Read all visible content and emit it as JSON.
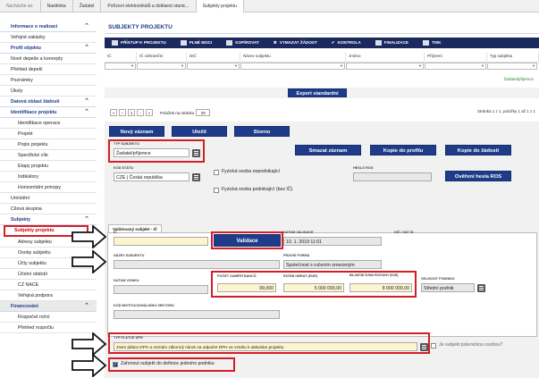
{
  "breadcrumb": [
    "Nastěnka",
    "Žadatel",
    "Pořízení elektronikálů a doblaest stanic...",
    "Subjekty projektu"
  ],
  "breadcrumb_home": "Nacházíte se:",
  "sidebar": {
    "items": [
      {
        "label": "Informace o realizaci",
        "type": "sec",
        "chev": "⌃"
      },
      {
        "label": "Veřejné zakázky",
        "type": "plain"
      },
      {
        "label": "Profil objektu",
        "type": "sec",
        "chev": "⌃"
      },
      {
        "label": "Nové depeše a koncepty",
        "type": "plain"
      },
      {
        "label": "Přehled depeší",
        "type": "plain"
      },
      {
        "label": "Poznámky",
        "type": "plain"
      },
      {
        "label": "Úkoly",
        "type": "plain"
      },
      {
        "label": "Datová oblast žádosti",
        "type": "sec",
        "chev": "⌃"
      },
      {
        "label": "Identifikace projektu",
        "type": "sec",
        "chev": "⌃"
      },
      {
        "label": "Identifikace operace",
        "type": "sub"
      },
      {
        "label": "Projekt",
        "type": "sub"
      },
      {
        "label": "Popis projektu",
        "type": "sub"
      },
      {
        "label": "Specifické cíle",
        "type": "sub"
      },
      {
        "label": "Etapy projektu",
        "type": "sub"
      },
      {
        "label": "Indikátory",
        "type": "sub"
      },
      {
        "label": "Horizontální principy",
        "type": "sub"
      },
      {
        "label": "Umístění",
        "type": "plain"
      },
      {
        "label": "Cílová skupina",
        "type": "plain"
      },
      {
        "label": "Subjekty",
        "type": "sec",
        "chev": "⌃"
      },
      {
        "label": "Subjekty projektu",
        "type": "active"
      },
      {
        "label": "Adresy subjektu",
        "type": "sub"
      },
      {
        "label": "Osoby subjektu",
        "type": "sub"
      },
      {
        "label": "Účty subjektu",
        "type": "sub"
      },
      {
        "label": "Účetní období",
        "type": "sub"
      },
      {
        "label": "CZ NACE",
        "type": "sub"
      },
      {
        "label": "Veřejná podpora",
        "type": "sub"
      },
      {
        "label": "Financování",
        "type": "secgrey",
        "chev": "⌃"
      },
      {
        "label": "Rozpočet roční",
        "type": "sub"
      },
      {
        "label": "Přehled rozpočtu",
        "type": "sub"
      }
    ]
  },
  "main": {
    "title": "SUBJEKTY PROJEKTU",
    "toolbar": [
      "PŘÍSTUP K PROJEKTU",
      "PLNÉ MOCI",
      "KOPÍROVAT",
      "VYMAZAT ŽÁDOST",
      "KONTROLA",
      "FINALIZACE",
      "TISK"
    ],
    "columns": [
      "IČ",
      "IČ zahraniční",
      "DIČ",
      "Název subjektu",
      "Jméno",
      "Příjmení",
      "Typ subjektu"
    ],
    "row_type": "Žadatel/přijemce",
    "export_label": "Export standardní",
    "pager": {
      "page": "1",
      "per_page_label": "Položek na stránku",
      "per_page": "25",
      "summary": "Stránka 1 z 1, položky 1 až 1 z 1"
    }
  },
  "form": {
    "btn_new": "Nový záznam",
    "btn_save": "Uložit",
    "btn_cancel": "Storno",
    "btn_delete": "Smazat záznam",
    "btn_copy_profile": "Kopie do profilu",
    "btn_copy_request": "Kopie do žádosti",
    "btn_verify_ros": "Ověření hesla ROS",
    "typ_subjektu_label": "TYP SUBJEKTU",
    "typ_subjektu": "Žadatel/příjemce",
    "kod_statu_label": "KÓD STÁTU",
    "kod_statu": "CZE | Česká republika",
    "fyz_nepod": "Fyzická osoba nepodnikající",
    "fyz_pod": "Fyzická osoba podnikající (bez IČ)",
    "heslo_ros_label": "HESLO ROS",
    "tab_label": "Validovaný subjekt - IČ",
    "ic_label": "IČ",
    "ic_value": "",
    "validace": "Validace",
    "datum_validace_label": "DATUM VALIDACE",
    "datum_validace": "10. 1. 2019 11:01",
    "dic_label": "DIČ / VAT ID",
    "nazev_label": "NÁZEV SUBJEKTU",
    "pravni_forma_label": "PRÁVNÍ FORMA",
    "pravni_forma": "Společnost s ručením omezeným",
    "datum_vzniku_label": "DATUM VZNIKU",
    "pocet_zam_label": "POČET ZAMĚSTNANCŮ",
    "pocet_zam": "99,000",
    "obrat_label": "ROČNÍ OBRAT (EUR)",
    "obrat": "5 000 000,00",
    "bilance_label": "BILANČNÍ SUMA ROZVAHY (EUR)",
    "bilance": "8 000 000,00",
    "velikost_label": "VELIKOST PODNIKU",
    "velikost": "Střední podnik",
    "kod_inst_label": "KÓD INSTITUCIONÁLNÍHO SEKTORU",
    "typ_platce_label": "TYP PLÁTCE DPH",
    "typ_platce": "Jsem plátce DPH a nemám zákonný nárok na odpočet DPH ve vztahu k aktivitám projektu",
    "pravnicka": "Je subjekt právnickou osobou?",
    "zahrnout": "Zahrnout subjekt do definice jednoho podniku"
  },
  "colors": {
    "navy": "#1f3c8a",
    "toolbar": "#1b2a5e",
    "red": "#d21f26",
    "green": "#2a8a2a"
  }
}
